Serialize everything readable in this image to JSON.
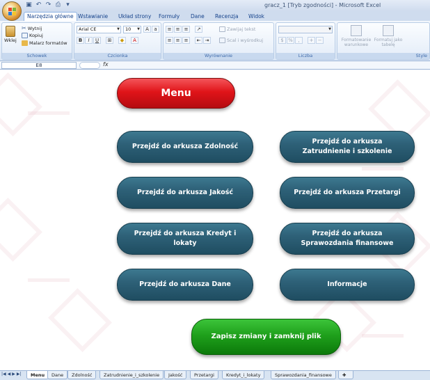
{
  "window": {
    "title": "gracz_1 [Tryb zgodności] - Microsoft Excel"
  },
  "ribbon": {
    "tabs": [
      "Narzędzia główne",
      "Wstawianie",
      "Układ strony",
      "Formuły",
      "Dane",
      "Recenzja",
      "Widok"
    ],
    "clipboard": {
      "paste": "Wklej",
      "cut": "Wytnij",
      "copy": "Kopiuj",
      "format_painter": "Malarz formatów",
      "label": "Schowek"
    },
    "font": {
      "name": "Arial CE",
      "size": "10",
      "label": "Czcionka"
    },
    "alignment": {
      "wrap": "Zawijaj tekst",
      "merge": "Scal i wyśrodkuj",
      "label": "Wyrównanie"
    },
    "number": {
      "label": "Liczba"
    },
    "styles": {
      "conditional": "Formatowanie warunkowe",
      "table": "Formatuj jako tabelę",
      "label": "Style"
    }
  },
  "formula_bar": {
    "cell": "E8",
    "fx": "fx"
  },
  "sheet": {
    "menu_button": "Menu",
    "buttons": [
      "Przejdź do arkusza Zdolność",
      "Przejdź do arkusza Zatrudnienie i szkolenie",
      "Przejdź do arkusza Jakość",
      "Przejdź do arkusza Przetargi",
      "Przejdź do arkusza Kredyt i lokaty",
      "Przejdź do arkusza Sprawozdania finansowe",
      "Przejdź do arkusza Dane",
      "Informacje"
    ],
    "save_button": "Zapisz zmiany i zamknij plik"
  },
  "sheet_tabs": [
    "Menu",
    "Dane",
    "Zdolność",
    "Zatrudnienie_i_szkolenie",
    "Jakość",
    "Przetargi",
    "Kredyt_i_lokaty",
    "Sprawozdania_finansowe"
  ],
  "colors": {
    "teal": "#2e6178",
    "red": "#e01419",
    "green": "#1fa01c"
  }
}
